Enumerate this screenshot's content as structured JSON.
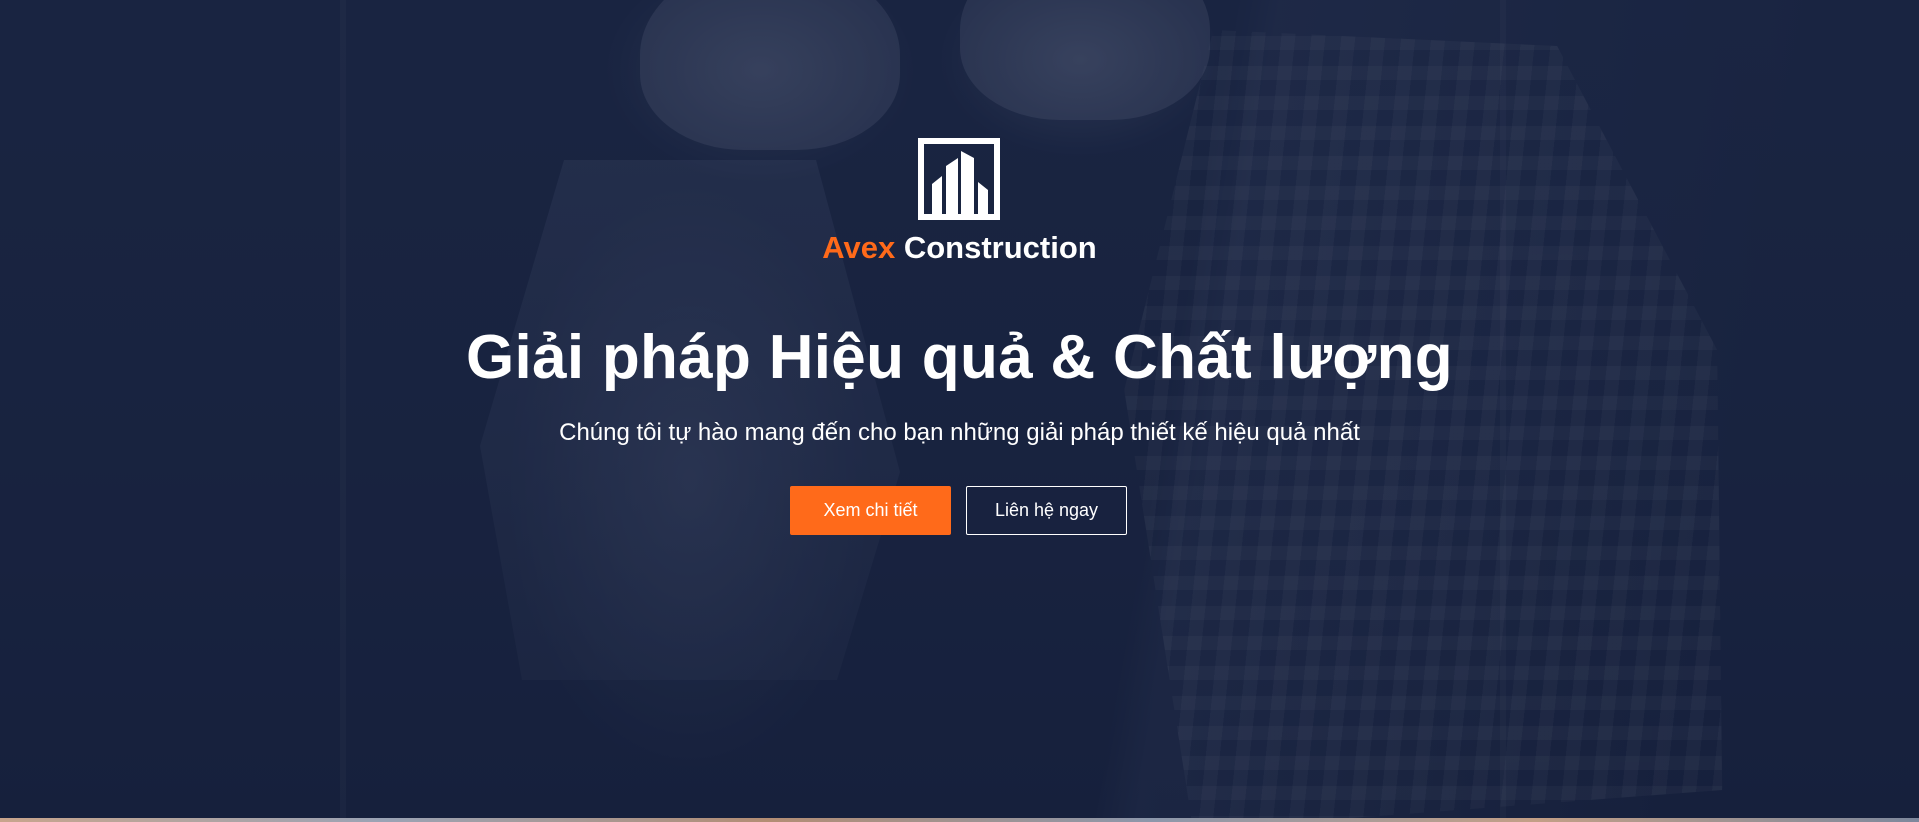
{
  "brand": {
    "accent": "Avex",
    "name": "Construction",
    "accent_color": "#ff6a1a",
    "logo_icon": "building-logo-icon"
  },
  "hero": {
    "headline": "Giải pháp Hiệu quả & Chất lượng",
    "subtitle": "Chúng tôi tự hào mang đến cho bạn những giải pháp thiết kế hiệu quả nhất",
    "primary_button": "Xem chi tiết",
    "secondary_button": "Liên hệ ngay",
    "overlay_color": "#16203e"
  }
}
